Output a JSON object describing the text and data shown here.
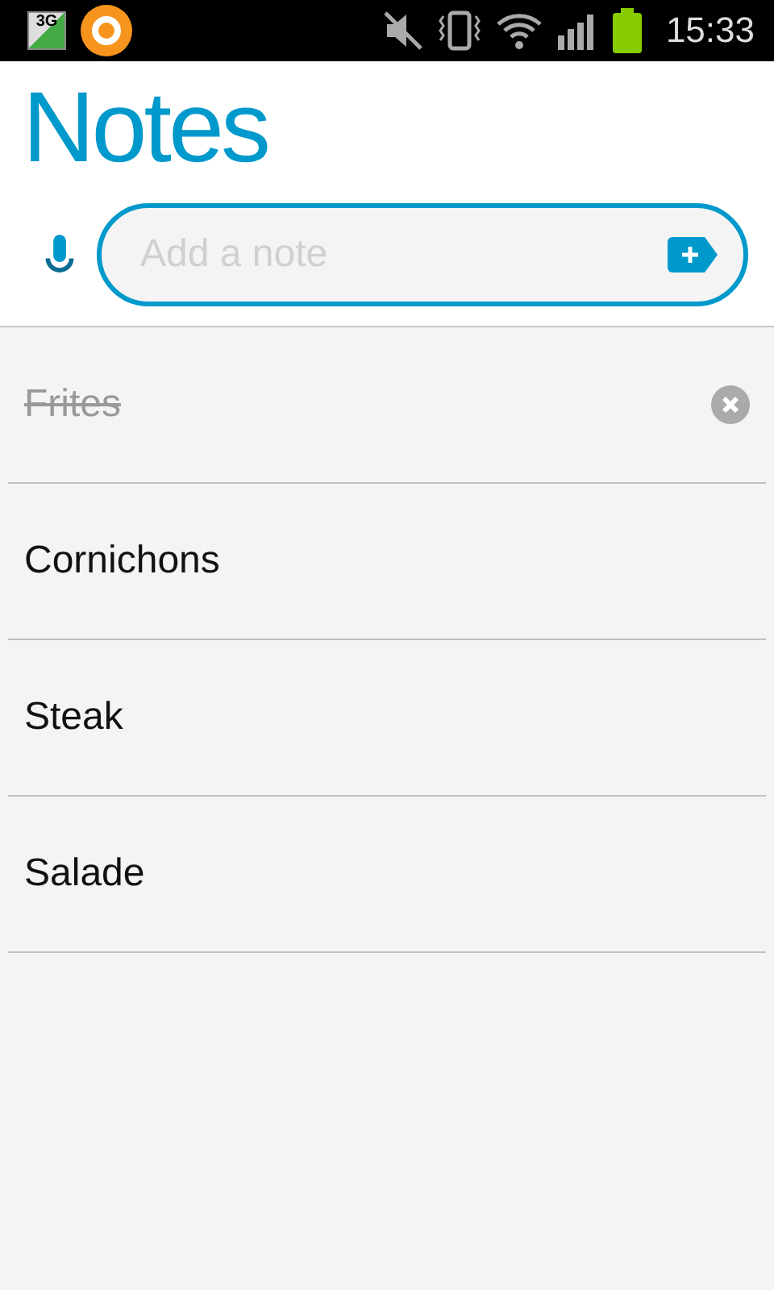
{
  "status_bar": {
    "network": "3G",
    "time": "15:33"
  },
  "title": "Notes",
  "note_input": {
    "placeholder": "Add a note"
  },
  "notes": [
    {
      "text": "Frites",
      "done": true
    },
    {
      "text": "Cornichons",
      "done": false
    },
    {
      "text": "Steak",
      "done": false
    },
    {
      "text": "Salade",
      "done": false
    }
  ]
}
